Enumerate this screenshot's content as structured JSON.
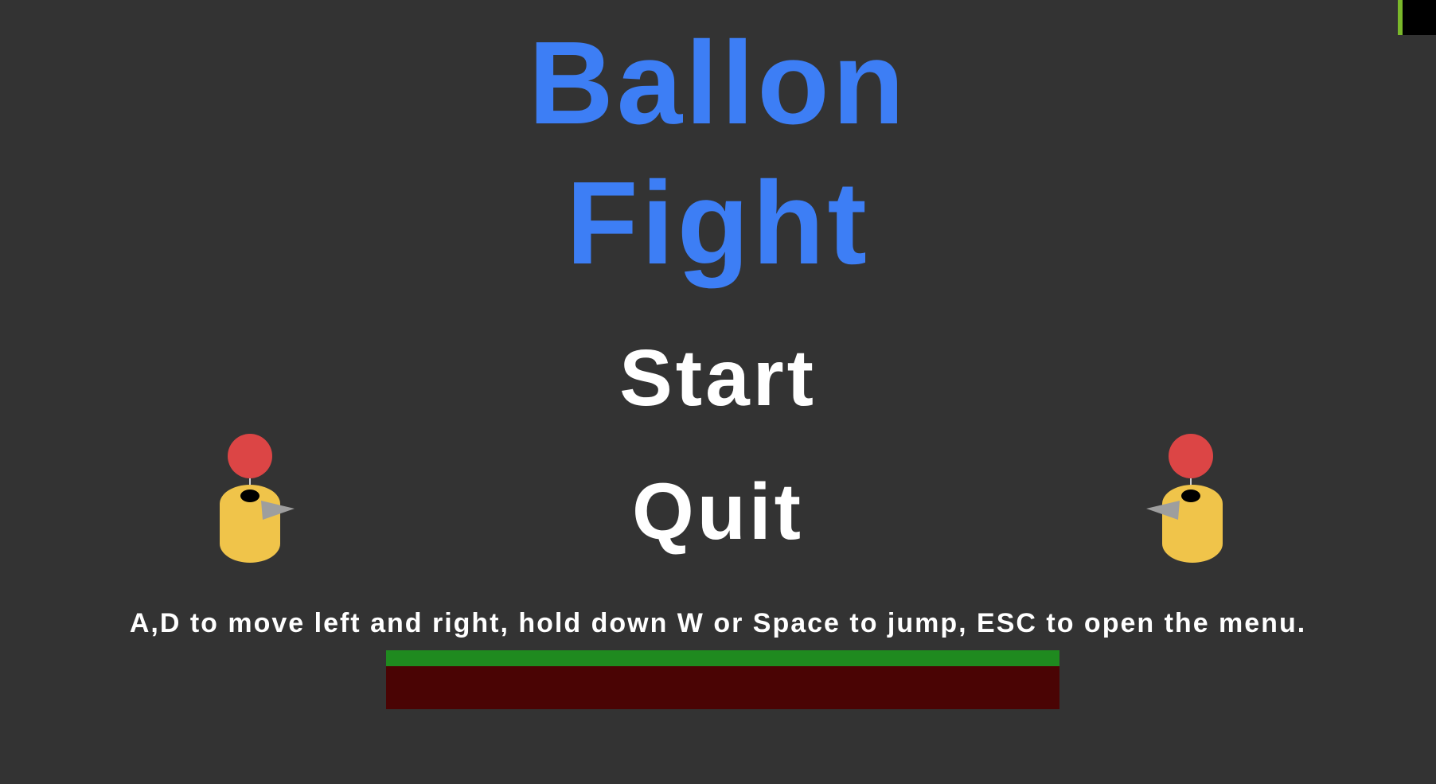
{
  "game": {
    "title_line1": "Ballon",
    "title_line2": "Fight"
  },
  "menu": {
    "start_label": "Start",
    "quit_label": "Quit"
  },
  "instructions": "A,D to move left and right, hold down W or Space to jump, ESC to open the menu.",
  "colors": {
    "background": "#333333",
    "title": "#3d7ef5",
    "menu_text": "#ffffff",
    "balloon": "#dc4545",
    "bird_body": "#f0c44a",
    "beak": "#9e9e9e",
    "grass": "#1f8a1f",
    "dirt": "#4a0404"
  },
  "icons": {
    "left_character": "balloon-bird-facing-right",
    "right_character": "balloon-bird-facing-left"
  }
}
